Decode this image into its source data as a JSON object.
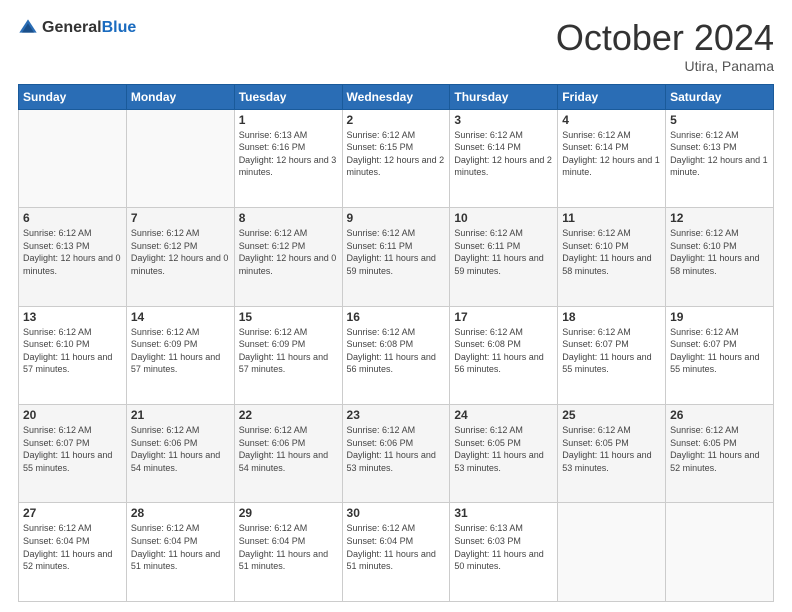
{
  "header": {
    "logo_general": "General",
    "logo_blue": "Blue",
    "month_title": "October 2024",
    "subtitle": "Utira, Panama"
  },
  "weekdays": [
    "Sunday",
    "Monday",
    "Tuesday",
    "Wednesday",
    "Thursday",
    "Friday",
    "Saturday"
  ],
  "weeks": [
    [
      {
        "day": "",
        "sunrise": "",
        "sunset": "",
        "daylight": ""
      },
      {
        "day": "",
        "sunrise": "",
        "sunset": "",
        "daylight": ""
      },
      {
        "day": "1",
        "sunrise": "Sunrise: 6:13 AM",
        "sunset": "Sunset: 6:16 PM",
        "daylight": "Daylight: 12 hours and 3 minutes."
      },
      {
        "day": "2",
        "sunrise": "Sunrise: 6:12 AM",
        "sunset": "Sunset: 6:15 PM",
        "daylight": "Daylight: 12 hours and 2 minutes."
      },
      {
        "day": "3",
        "sunrise": "Sunrise: 6:12 AM",
        "sunset": "Sunset: 6:14 PM",
        "daylight": "Daylight: 12 hours and 2 minutes."
      },
      {
        "day": "4",
        "sunrise": "Sunrise: 6:12 AM",
        "sunset": "Sunset: 6:14 PM",
        "daylight": "Daylight: 12 hours and 1 minute."
      },
      {
        "day": "5",
        "sunrise": "Sunrise: 6:12 AM",
        "sunset": "Sunset: 6:13 PM",
        "daylight": "Daylight: 12 hours and 1 minute."
      }
    ],
    [
      {
        "day": "6",
        "sunrise": "Sunrise: 6:12 AM",
        "sunset": "Sunset: 6:13 PM",
        "daylight": "Daylight: 12 hours and 0 minutes."
      },
      {
        "day": "7",
        "sunrise": "Sunrise: 6:12 AM",
        "sunset": "Sunset: 6:12 PM",
        "daylight": "Daylight: 12 hours and 0 minutes."
      },
      {
        "day": "8",
        "sunrise": "Sunrise: 6:12 AM",
        "sunset": "Sunset: 6:12 PM",
        "daylight": "Daylight: 12 hours and 0 minutes."
      },
      {
        "day": "9",
        "sunrise": "Sunrise: 6:12 AM",
        "sunset": "Sunset: 6:11 PM",
        "daylight": "Daylight: 11 hours and 59 minutes."
      },
      {
        "day": "10",
        "sunrise": "Sunrise: 6:12 AM",
        "sunset": "Sunset: 6:11 PM",
        "daylight": "Daylight: 11 hours and 59 minutes."
      },
      {
        "day": "11",
        "sunrise": "Sunrise: 6:12 AM",
        "sunset": "Sunset: 6:10 PM",
        "daylight": "Daylight: 11 hours and 58 minutes."
      },
      {
        "day": "12",
        "sunrise": "Sunrise: 6:12 AM",
        "sunset": "Sunset: 6:10 PM",
        "daylight": "Daylight: 11 hours and 58 minutes."
      }
    ],
    [
      {
        "day": "13",
        "sunrise": "Sunrise: 6:12 AM",
        "sunset": "Sunset: 6:10 PM",
        "daylight": "Daylight: 11 hours and 57 minutes."
      },
      {
        "day": "14",
        "sunrise": "Sunrise: 6:12 AM",
        "sunset": "Sunset: 6:09 PM",
        "daylight": "Daylight: 11 hours and 57 minutes."
      },
      {
        "day": "15",
        "sunrise": "Sunrise: 6:12 AM",
        "sunset": "Sunset: 6:09 PM",
        "daylight": "Daylight: 11 hours and 57 minutes."
      },
      {
        "day": "16",
        "sunrise": "Sunrise: 6:12 AM",
        "sunset": "Sunset: 6:08 PM",
        "daylight": "Daylight: 11 hours and 56 minutes."
      },
      {
        "day": "17",
        "sunrise": "Sunrise: 6:12 AM",
        "sunset": "Sunset: 6:08 PM",
        "daylight": "Daylight: 11 hours and 56 minutes."
      },
      {
        "day": "18",
        "sunrise": "Sunrise: 6:12 AM",
        "sunset": "Sunset: 6:07 PM",
        "daylight": "Daylight: 11 hours and 55 minutes."
      },
      {
        "day": "19",
        "sunrise": "Sunrise: 6:12 AM",
        "sunset": "Sunset: 6:07 PM",
        "daylight": "Daylight: 11 hours and 55 minutes."
      }
    ],
    [
      {
        "day": "20",
        "sunrise": "Sunrise: 6:12 AM",
        "sunset": "Sunset: 6:07 PM",
        "daylight": "Daylight: 11 hours and 55 minutes."
      },
      {
        "day": "21",
        "sunrise": "Sunrise: 6:12 AM",
        "sunset": "Sunset: 6:06 PM",
        "daylight": "Daylight: 11 hours and 54 minutes."
      },
      {
        "day": "22",
        "sunrise": "Sunrise: 6:12 AM",
        "sunset": "Sunset: 6:06 PM",
        "daylight": "Daylight: 11 hours and 54 minutes."
      },
      {
        "day": "23",
        "sunrise": "Sunrise: 6:12 AM",
        "sunset": "Sunset: 6:06 PM",
        "daylight": "Daylight: 11 hours and 53 minutes."
      },
      {
        "day": "24",
        "sunrise": "Sunrise: 6:12 AM",
        "sunset": "Sunset: 6:05 PM",
        "daylight": "Daylight: 11 hours and 53 minutes."
      },
      {
        "day": "25",
        "sunrise": "Sunrise: 6:12 AM",
        "sunset": "Sunset: 6:05 PM",
        "daylight": "Daylight: 11 hours and 53 minutes."
      },
      {
        "day": "26",
        "sunrise": "Sunrise: 6:12 AM",
        "sunset": "Sunset: 6:05 PM",
        "daylight": "Daylight: 11 hours and 52 minutes."
      }
    ],
    [
      {
        "day": "27",
        "sunrise": "Sunrise: 6:12 AM",
        "sunset": "Sunset: 6:04 PM",
        "daylight": "Daylight: 11 hours and 52 minutes."
      },
      {
        "day": "28",
        "sunrise": "Sunrise: 6:12 AM",
        "sunset": "Sunset: 6:04 PM",
        "daylight": "Daylight: 11 hours and 51 minutes."
      },
      {
        "day": "29",
        "sunrise": "Sunrise: 6:12 AM",
        "sunset": "Sunset: 6:04 PM",
        "daylight": "Daylight: 11 hours and 51 minutes."
      },
      {
        "day": "30",
        "sunrise": "Sunrise: 6:12 AM",
        "sunset": "Sunset: 6:04 PM",
        "daylight": "Daylight: 11 hours and 51 minutes."
      },
      {
        "day": "31",
        "sunrise": "Sunrise: 6:13 AM",
        "sunset": "Sunset: 6:03 PM",
        "daylight": "Daylight: 11 hours and 50 minutes."
      },
      {
        "day": "",
        "sunrise": "",
        "sunset": "",
        "daylight": ""
      },
      {
        "day": "",
        "sunrise": "",
        "sunset": "",
        "daylight": ""
      }
    ]
  ]
}
